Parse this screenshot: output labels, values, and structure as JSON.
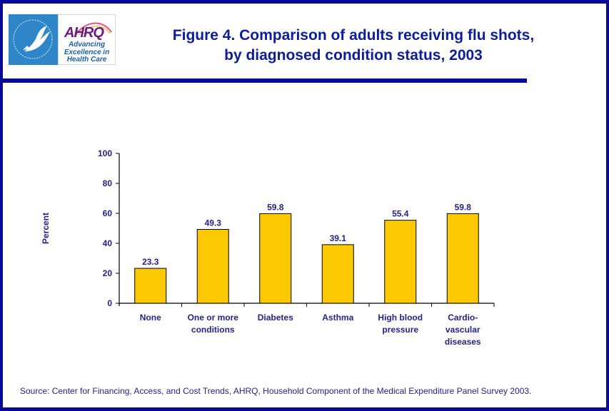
{
  "header": {
    "title_line1": "Figure 4. Comparison of adults receiving flu shots,",
    "title_line2": "by diagnosed condition status, 2003",
    "logos": {
      "hhs": "hhs-eagle-seal-icon",
      "ahrq_mark": "AHRQ",
      "ahrq_tagline": [
        "Advancing",
        "Excellence in",
        "Health Care"
      ]
    }
  },
  "colors": {
    "frame": "#0a0a99",
    "title": "#0d1d9a",
    "text": "#23238a",
    "bar_fill": "#ffcc00",
    "bar_stroke": "#000000"
  },
  "chart_data": {
    "type": "bar",
    "title": "Figure 4. Comparison of adults receiving flu shots, by diagnosed condition status, 2003",
    "xlabel": "",
    "ylabel": "Percent",
    "ylim": [
      0,
      100
    ],
    "yticks": [
      0,
      20,
      40,
      60,
      80,
      100
    ],
    "grid": false,
    "legend": "none",
    "categories": [
      [
        "None"
      ],
      [
        "One or more",
        "conditions"
      ],
      [
        "Diabetes"
      ],
      [
        "Asthma"
      ],
      [
        "High blood",
        "pressure"
      ],
      [
        "Cardio-",
        "vascular",
        "diseases"
      ]
    ],
    "values": [
      23.3,
      49.3,
      59.8,
      39.1,
      55.4,
      59.8
    ],
    "value_labels": [
      "23.3",
      "49.3",
      "59.8",
      "39.1",
      "55.4",
      "59.8"
    ]
  },
  "footer": {
    "source": "Source: Center for Financing, Access, and Cost Trends, AHRQ, Household Component of the Medical Expenditure Panel Survey 2003."
  }
}
